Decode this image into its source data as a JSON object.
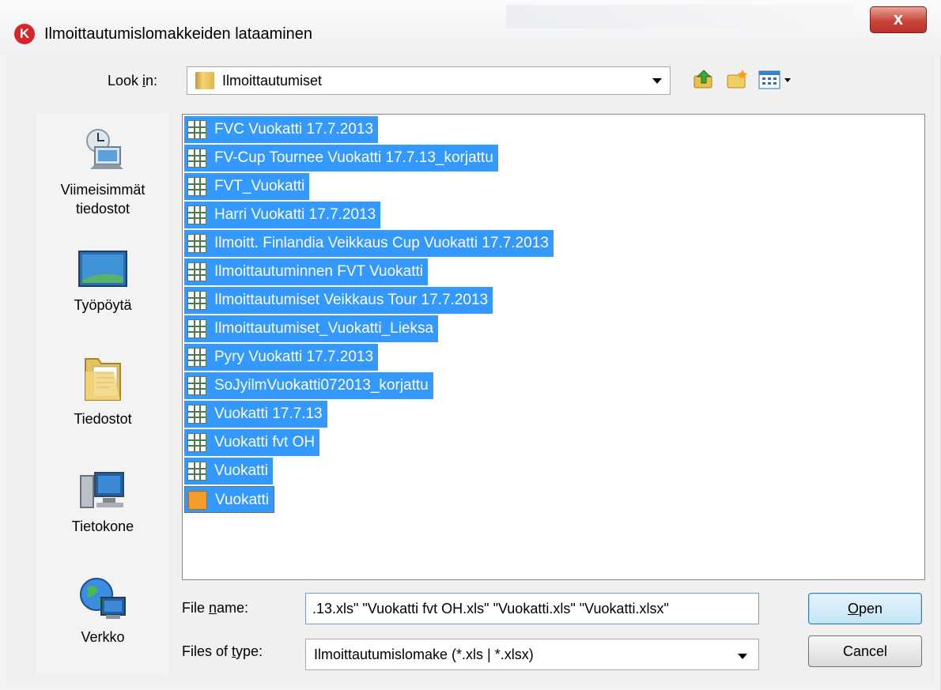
{
  "window": {
    "title": "Ilmoittautumislomakkeiden lataaminen",
    "app_icon_letter": "K",
    "close_label": "x"
  },
  "lookin": {
    "label_pre": "Look ",
    "label_u": "i",
    "label_post": "n:",
    "value": "Ilmoittautumiset"
  },
  "toolbar": {
    "up_icon": "up-folder-icon",
    "new_icon": "new-folder-icon",
    "view_icon": "view-menu-icon"
  },
  "places": [
    {
      "label": "Viimeisimmät tiedostot",
      "icon": "recent-items-icon"
    },
    {
      "label": "Työpöytä",
      "icon": "desktop-icon"
    },
    {
      "label": "Tiedostot",
      "icon": "documents-icon"
    },
    {
      "label": "Tietokone",
      "icon": "computer-icon"
    },
    {
      "label": "Verkko",
      "icon": "network-icon"
    }
  ],
  "files": [
    {
      "name": "FVC Vuokatti 17.7.2013",
      "type": "xls"
    },
    {
      "name": "FV-Cup Tournee Vuokatti 17.7.13_korjattu",
      "type": "xls"
    },
    {
      "name": "FVT_Vuokatti",
      "type": "xls"
    },
    {
      "name": "Harri Vuokatti 17.7.2013",
      "type": "xls"
    },
    {
      "name": "Ilmoitt. Finlandia Veikkaus Cup Vuokatti 17.7.2013",
      "type": "xls"
    },
    {
      "name": "Ilmoittautuminnen FVT Vuokatti",
      "type": "xls"
    },
    {
      "name": "Ilmoittautumiset Veikkaus Tour 17.7.2013",
      "type": "xls"
    },
    {
      "name": "Ilmoittautumiset_Vuokatti_Lieksa",
      "type": "xls"
    },
    {
      "name": "Pyry Vuokatti 17.7.2013",
      "type": "xls"
    },
    {
      "name": "SoJyilmVuokatti072013_korjattu",
      "type": "xls"
    },
    {
      "name": "Vuokatti 17.7.13",
      "type": "xls"
    },
    {
      "name": "Vuokatti fvt OH",
      "type": "xls"
    },
    {
      "name": "Vuokatti",
      "type": "xls"
    },
    {
      "name": "Vuokatti",
      "type": "xlsx"
    }
  ],
  "filename": {
    "label_pre": "File ",
    "label_u": "n",
    "label_post": "ame:",
    "value": ".13.xls\" \"Vuokatti fvt OH.xls\" \"Vuokatti.xls\" \"Vuokatti.xlsx\""
  },
  "filetype": {
    "label_pre": "Files of ",
    "label_u": "t",
    "label_post": "ype:",
    "value": "Ilmoittautumislomake (*.xls | *.xlsx)"
  },
  "buttons": {
    "open_u": "O",
    "open_rest": "pen",
    "cancel": "Cancel"
  }
}
